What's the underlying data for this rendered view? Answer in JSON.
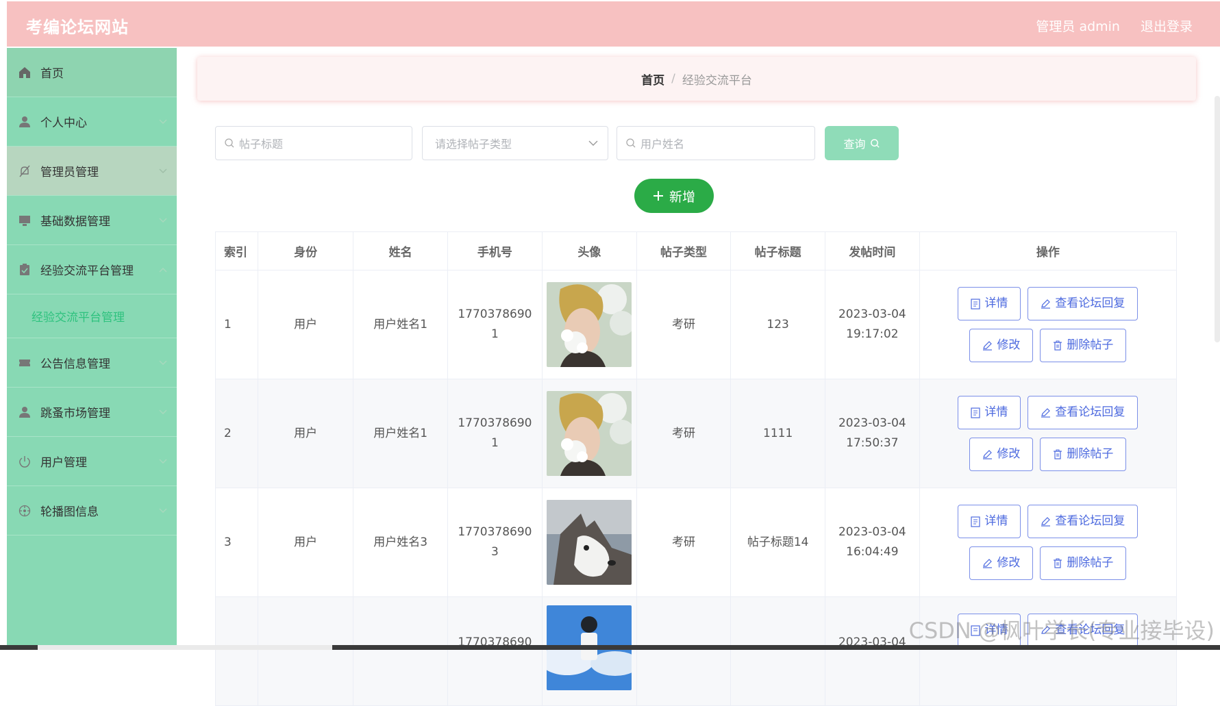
{
  "header": {
    "site_title": "考编论坛网站",
    "user_label": "管理员 admin",
    "logout_label": "退出登录"
  },
  "sidebar": {
    "items": [
      {
        "label": "首页",
        "icon": "home-icon"
      },
      {
        "label": "个人中心",
        "icon": "user-icon"
      },
      {
        "label": "管理员管理",
        "icon": "bell-off-icon"
      },
      {
        "label": "基础数据管理",
        "icon": "monitor-icon"
      },
      {
        "label": "经验交流平台管理",
        "icon": "clipboard-icon",
        "expanded": true
      },
      {
        "label": "公告信息管理",
        "icon": "ticket-icon"
      },
      {
        "label": "跳蚤市场管理",
        "icon": "user-icon"
      },
      {
        "label": "用户管理",
        "icon": "power-icon"
      },
      {
        "label": "轮播图信息",
        "icon": "compass-icon"
      }
    ],
    "subitem": "经验交流平台管理",
    "active_color": "#2ec27e"
  },
  "breadcrumb": {
    "home": "首页",
    "separator": "/",
    "current": "经验交流平台"
  },
  "search": {
    "title_placeholder": "帖子标题",
    "type_placeholder": "请选择帖子类型",
    "user_placeholder": "用户姓名",
    "query_label": "查询"
  },
  "add_label": "新增",
  "table": {
    "headers": [
      "索引",
      "身份",
      "姓名",
      "手机号",
      "头像",
      "帖子类型",
      "帖子标题",
      "发帖时间",
      "操作"
    ],
    "rows": [
      {
        "index": "1",
        "role": "用户",
        "name": "用户姓名1",
        "phone_a": "1770378690",
        "phone_b": "1",
        "type": "考研",
        "title": "123",
        "date": "2023-03-04",
        "time": "19:17:02"
      },
      {
        "index": "2",
        "role": "用户",
        "name": "用户姓名1",
        "phone_a": "1770378690",
        "phone_b": "1",
        "type": "考研",
        "title": "1111",
        "date": "2023-03-04",
        "time": "17:50:37"
      },
      {
        "index": "3",
        "role": "用户",
        "name": "用户姓名3",
        "phone_a": "1770378690",
        "phone_b": "3",
        "type": "考研",
        "title": "帖子标题14",
        "date": "2023-03-04",
        "time": "16:04:49"
      },
      {
        "phone_a": "1770378690",
        "date": "2023-03-04"
      }
    ],
    "ops": {
      "detail": "详情",
      "view_reply": "查看论坛回复",
      "edit": "修改",
      "delete": "删除帖子"
    }
  },
  "watermark": "CSDN @枫叶学长(专业接毕设)",
  "colors": {
    "header_bg": "#f7c1c1",
    "sidebar_bg": "#88d9b4",
    "add_button": "#2bab47",
    "query_button": "#8fdcb8",
    "op_border": "#7a8ee8"
  }
}
